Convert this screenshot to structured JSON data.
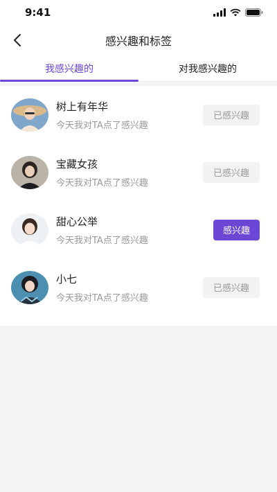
{
  "status": {
    "time": "9:41"
  },
  "header": {
    "title": "感兴趣和标签"
  },
  "tabs": [
    {
      "label": "我感兴趣的",
      "active": true
    },
    {
      "label": "对我感兴趣的",
      "active": false
    }
  ],
  "users": [
    {
      "name": "树上有年华",
      "desc": "今天我对TA点了感兴趣",
      "button": "已感兴趣",
      "state": "done"
    },
    {
      "name": "宝藏女孩",
      "desc": "今天我对TA点了感兴趣",
      "button": "已感兴趣",
      "state": "done"
    },
    {
      "name": "甜心公举",
      "desc": "今天我对TA点了感兴趣",
      "button": "感兴趣",
      "state": "primary"
    },
    {
      "name": "小七",
      "desc": "今天我对TA点了感兴趣",
      "button": "已感兴趣",
      "state": "done"
    }
  ],
  "colors": {
    "accent": "#6c47d6",
    "muted_button": "#f2f2f5",
    "page_bg": "#f5f5f8"
  },
  "icons": [
    "back-arrow-icon",
    "signal-icon",
    "wifi-icon",
    "battery-icon"
  ]
}
